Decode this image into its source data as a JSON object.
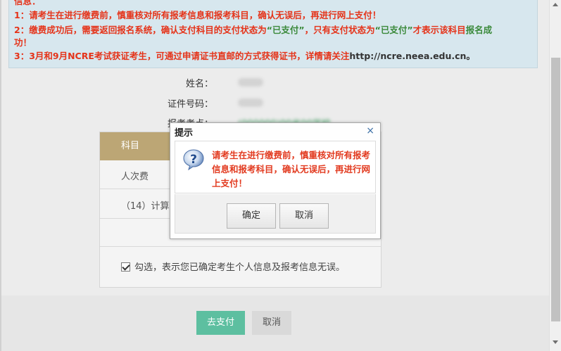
{
  "notice": {
    "header": "信息：",
    "line1": "1：请考生在进行缴费前，慎重核对所有报考信息和报考科目，确认无误后，再进行网上支付！",
    "line2_a": "2：缴费成功后，需要返回报名系统，确认支付科目的支付状态为",
    "line2_q1": "“已支付”",
    "line2_b": "，只有支付状态为",
    "line2_q2": "“已支付”",
    "line2_c": "才表示该科目",
    "line2_d": "报名成",
    "line2_e": "功！",
    "line3_a": "3：3月和9月NCRE考试获证考生，可通过申请证书直邮的方式获得证书，详情请关注",
    "line3_url": "http://ncre.neea.edu.cn",
    "line3_end": "。"
  },
  "info": {
    "name_label": "姓名：",
    "id_label": "证件号码：",
    "exam_label": "报考考点：",
    "exam_value": "(000000)00省00学校"
  },
  "table": {
    "col_subject": "科目",
    "row_fee": "人次费",
    "row_subject": "（14）计算",
    "confirm_text": "勾选，表示您已确定考生个人信息及报考信息无误。"
  },
  "buttons": {
    "pay": "去支付",
    "cancel": "取消"
  },
  "dialog": {
    "title": "提示",
    "close": "×",
    "message": "请考生在进行缴费前，慎重核对所有报考信息和报考科目，确认无误后，再进行网上支付！",
    "ok": "确定",
    "cancel": "取消"
  },
  "colors": {
    "accent_green": "#5dbfa0",
    "notice_red": "#e53319",
    "tab_gold": "#bca675",
    "notice_bg": "#d7e7ee"
  }
}
